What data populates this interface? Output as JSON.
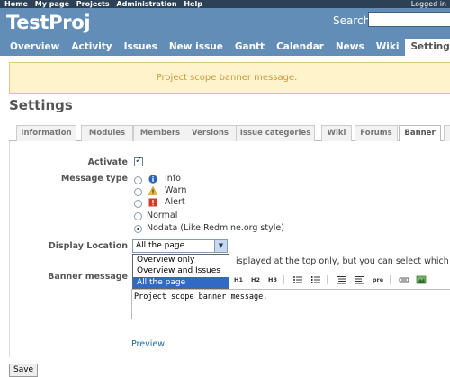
{
  "top_menu": {
    "items": [
      "Home",
      "My page",
      "Projects",
      "Administration",
      "Help"
    ],
    "logged_in": "Logged in"
  },
  "header": {
    "project_name": "TestProj",
    "search_label": "Search:",
    "search_value": ""
  },
  "main_tabs": [
    {
      "label": "Overview"
    },
    {
      "label": "Activity"
    },
    {
      "label": "Issues"
    },
    {
      "label": "New issue"
    },
    {
      "label": "Gantt"
    },
    {
      "label": "Calendar"
    },
    {
      "label": "News"
    },
    {
      "label": "Wiki"
    },
    {
      "label": "Settings",
      "selected": true
    }
  ],
  "banner": {
    "message": "Project scope banner message."
  },
  "page_title": "Settings",
  "settings_tabs": [
    {
      "label": "Information"
    },
    {
      "label": "Modules"
    },
    {
      "label": "Members"
    },
    {
      "label": "Versions"
    },
    {
      "label": "Issue categories"
    },
    {
      "label": "Wiki"
    },
    {
      "label": "Forums"
    },
    {
      "label": "Banner",
      "selected": true
    }
  ],
  "form": {
    "activate_label": "Activate",
    "activate_checked": true,
    "message_type_label": "Message type",
    "message_types": [
      {
        "label": "Info",
        "icon": "info-icon",
        "checked": false
      },
      {
        "label": "Warn",
        "icon": "warning-icon",
        "checked": false
      },
      {
        "label": "Alert",
        "icon": "alert-icon",
        "checked": false
      },
      {
        "label": "Normal",
        "icon": "",
        "checked": false
      },
      {
        "label": "Nodata (Like Redmine.org style)",
        "icon": "",
        "checked": true
      }
    ],
    "display_location_label": "Display Location",
    "display_location_selected": "All the page",
    "display_location_options": [
      "Overview only",
      "Overview and Issues",
      "All the page"
    ],
    "help_text": "isplayed at the top only, but you can select which pa",
    "banner_message_label": "Banner message",
    "toolbar": [
      "H1",
      "H2",
      "H3",
      "pre"
    ],
    "banner_message_value": "Project scope banner message."
  },
  "preview_label": "Preview",
  "save_label": "Save",
  "colors": {
    "header_bg": "#628db6",
    "top_menu_bg": "#2c4056",
    "banner_bg": "#fff3cc",
    "banner_text": "#c39b3c",
    "link": "#1e6aa8"
  }
}
